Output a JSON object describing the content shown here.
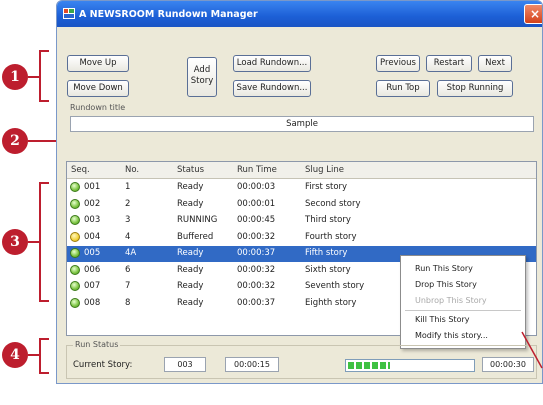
{
  "window": {
    "title": "A NEWSROOM Rundown Manager",
    "close_glyph": "×"
  },
  "toolbar": {
    "move_up": "Move Up",
    "move_down": "Move Down",
    "add_story_line1": "Add",
    "add_story_line2": "Story",
    "load_rundown": "Load Rundown...",
    "save_rundown": "Save Rundown...",
    "previous": "Previous",
    "restart": "Restart",
    "next": "Next",
    "run_top": "Run Top",
    "stop_running": "Stop Running"
  },
  "rundown_title": {
    "label": "Rundown title",
    "value": "Sample"
  },
  "list": {
    "columns": [
      "Seq.",
      "No.",
      "Status",
      "Run Time",
      "Slug Line"
    ],
    "rows": [
      {
        "seq": "001",
        "no": "1",
        "status": "Ready",
        "run_time": "00:00:03",
        "slug": "First story",
        "dot": "green",
        "selected": false
      },
      {
        "seq": "002",
        "no": "2",
        "status": "Ready",
        "run_time": "00:00:01",
        "slug": "Second story",
        "dot": "green",
        "selected": false
      },
      {
        "seq": "003",
        "no": "3",
        "status": "RUNNING",
        "run_time": "00:00:45",
        "slug": "Third story",
        "dot": "green",
        "selected": false
      },
      {
        "seq": "004",
        "no": "4",
        "status": "Buffered",
        "run_time": "00:00:32",
        "slug": "Fourth story",
        "dot": "yellow",
        "selected": false
      },
      {
        "seq": "005",
        "no": "4A",
        "status": "Ready",
        "run_time": "00:00:37",
        "slug": "Fifth story",
        "dot": "green",
        "selected": true
      },
      {
        "seq": "006",
        "no": "6",
        "status": "Ready",
        "run_time": "00:00:32",
        "slug": "Sixth story",
        "dot": "green",
        "selected": false
      },
      {
        "seq": "007",
        "no": "7",
        "status": "Ready",
        "run_time": "00:00:32",
        "slug": "Seventh story",
        "dot": "green",
        "selected": false
      },
      {
        "seq": "008",
        "no": "8",
        "status": "Ready",
        "run_time": "00:00:37",
        "slug": "Eighth story",
        "dot": "green",
        "selected": false
      }
    ]
  },
  "context_menu": {
    "items": [
      {
        "label": "Run This Story",
        "disabled": false
      },
      {
        "label": "Drop This Story",
        "disabled": false
      },
      {
        "label": "Unbrop This Story",
        "disabled": true
      },
      {
        "label": "Kill This Story",
        "disabled": false
      },
      {
        "label": "Modify this story...",
        "disabled": false
      }
    ]
  },
  "run_status": {
    "label": "Run Status",
    "current_story_label": "Current Story:",
    "current_story": "003",
    "elapsed": "00:00:15",
    "progress": 0.33,
    "total": "00:00:30"
  },
  "callouts": [
    "1",
    "2",
    "3",
    "4"
  ],
  "colors": {
    "callout": "#bd1e2e",
    "selection": "#316ac5",
    "titlebar": "#1c5fd6"
  }
}
